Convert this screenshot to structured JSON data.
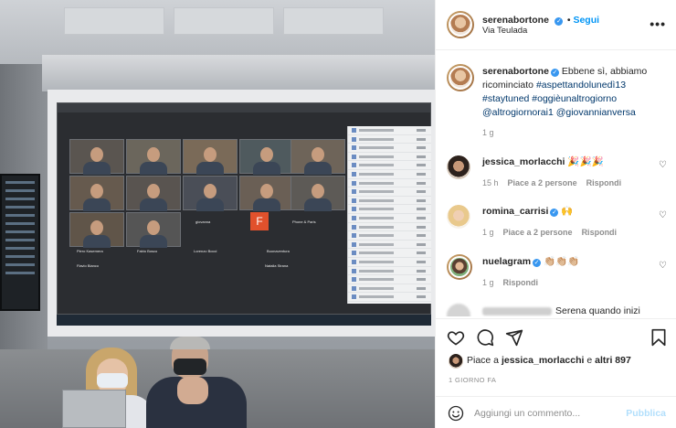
{
  "post": {
    "author": "serenabortone",
    "follow_label": "Segui",
    "location": "Via Teulada",
    "more_label": "•••"
  },
  "caption": {
    "username": "serenabortone",
    "text_plain": "Ebbene sì, abbiamo ricominciato",
    "hashtags": "#aspettandolunedì13 #staytuned #oggièunaltrogiorno",
    "mentions": "@altrogiornorai1 @giovannianversa",
    "time": "1 g"
  },
  "comments": [
    {
      "username": "jessica_morlacchi",
      "text": "🎉🎉🎉",
      "time": "15 h",
      "likes": "Piace a 2 persone",
      "reply": "Rispondi",
      "verified": false
    },
    {
      "username": "romina_carrisi",
      "text": "🙌",
      "time": "1 g",
      "likes": "Piace a 2 persone",
      "reply": "Rispondi",
      "verified": true
    },
    {
      "username": "nuelagram",
      "text": "👏🏼👏🏼👏🏼",
      "time": "1 g",
      "likes": "",
      "reply": "Rispondi",
      "verified": true
    },
    {
      "username": "",
      "text": "Serena quando inizi",
      "time": "",
      "likes": "",
      "reply": "",
      "verified": false
    }
  ],
  "likes": {
    "prefix": "Piace a ",
    "user": "jessica_morlacchi",
    "middle": " e ",
    "others": "altri 897"
  },
  "time_ago": "1 GIORNO FA",
  "add_comment": {
    "placeholder": "Aggiungi un commento...",
    "publish_label": "Pubblica"
  },
  "photo": {
    "tile_labels": [
      "giovanna",
      "Phone & Paris",
      "Flavio Bianco",
      "Lorenzo Bocci",
      "Natalia Strana",
      "Buonaventura",
      "Piero Kasemera",
      "Fabio Bosco"
    ],
    "f_avatar": "F"
  },
  "colors": {
    "link": "#00376b",
    "accent": "#0095f6",
    "muted": "#8e8e8e",
    "divider": "#efefef"
  },
  "icons": [
    "heart-icon",
    "comment-icon",
    "share-icon",
    "bookmark-icon",
    "emoji-icon",
    "verified-icon",
    "more-icon"
  ]
}
